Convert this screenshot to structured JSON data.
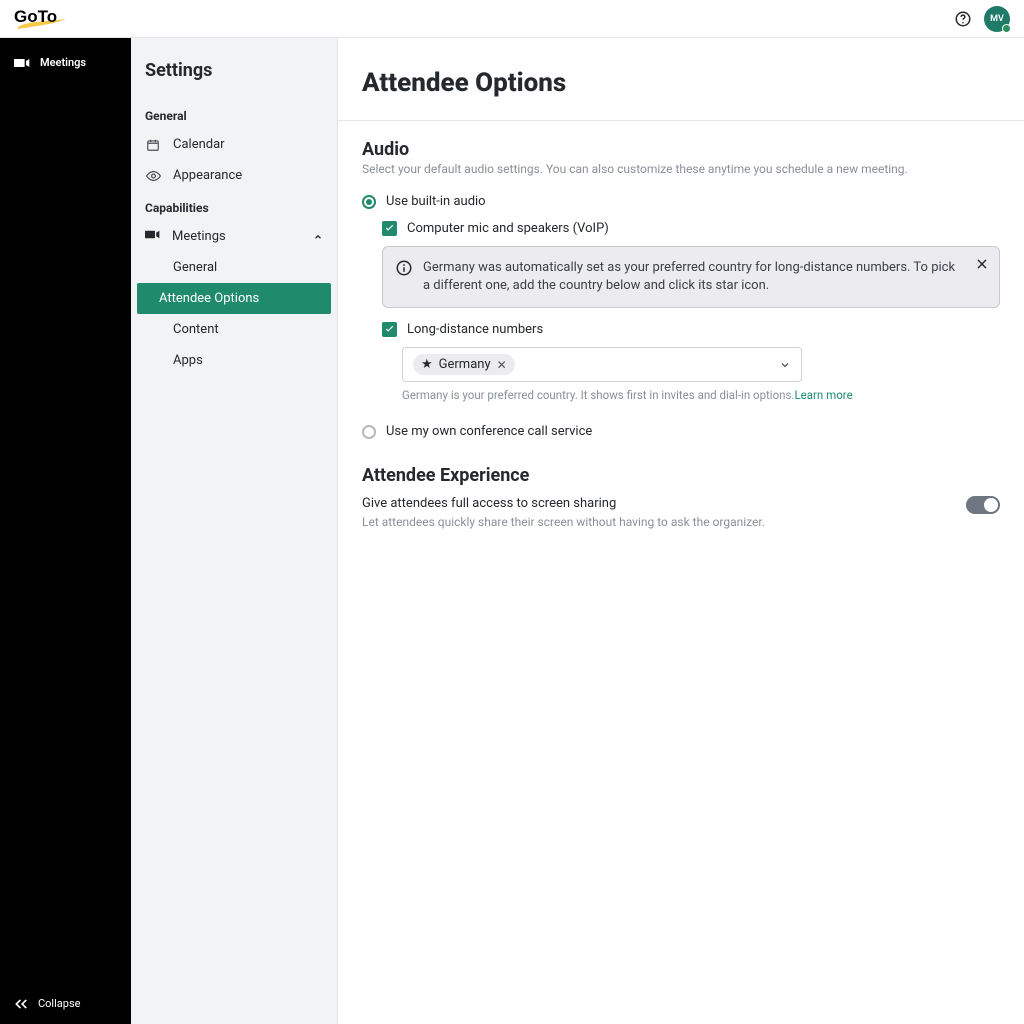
{
  "brand": "GoTo",
  "avatar_initials": "MV",
  "blackbar": {
    "meetings": "Meetings",
    "collapse": "Collapse"
  },
  "sidebar": {
    "title": "Settings",
    "section_general": "General",
    "calendar": "Calendar",
    "appearance": "Appearance",
    "section_capabilities": "Capabilities",
    "meetings": "Meetings",
    "sub_general": "General",
    "sub_attendee": "Attendee Options",
    "sub_content": "Content",
    "sub_apps": "Apps"
  },
  "page": {
    "title": "Attendee Options"
  },
  "audio": {
    "heading": "Audio",
    "desc": "Select your default audio settings. You can also customize these anytime you schedule a new meeting.",
    "use_builtin": "Use built-in audio",
    "voip": "Computer mic and speakers (VoIP)",
    "info": "Germany was automatically set as your preferred country for long-distance numbers. To pick a different one, add the country below and click its star icon.",
    "long_distance": "Long-distance numbers",
    "country_chip": "Germany",
    "hint_pre": "Germany is your preferred country. It shows first in invites and dial-in options.",
    "hint_link": "Learn more",
    "own_service": "Use my own conference call service"
  },
  "experience": {
    "heading": "Attendee Experience",
    "row1_title": "Give attendees full access to screen sharing",
    "row1_desc": "Let attendees quickly share their screen without having to ask the organizer."
  }
}
